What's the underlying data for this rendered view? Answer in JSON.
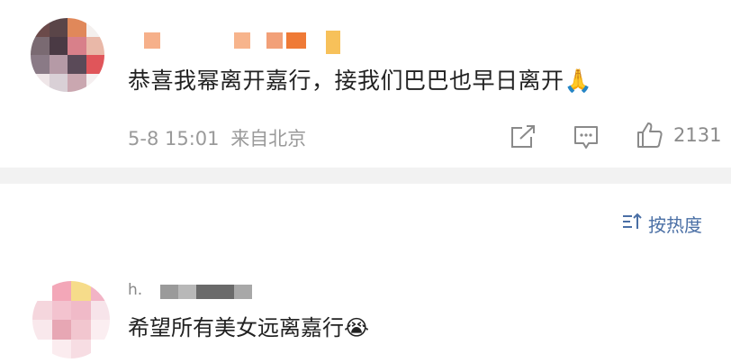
{
  "comment1": {
    "text": "恭喜我幂离开嘉行，接我们巴巴也早日离开",
    "emoji": "🙏",
    "timestamp": "5-8 15:01",
    "location": "来自北京",
    "like_count": "2131"
  },
  "sort": {
    "label": "按热度"
  },
  "comment2": {
    "username_prefix": "h.",
    "text": "希望所有美女远离嘉行",
    "emoji": "😭"
  },
  "colors": {
    "accent_blue": "#4a6fa5",
    "meta_gray": "#9a9a9a",
    "divider": "#f2f2f2"
  }
}
